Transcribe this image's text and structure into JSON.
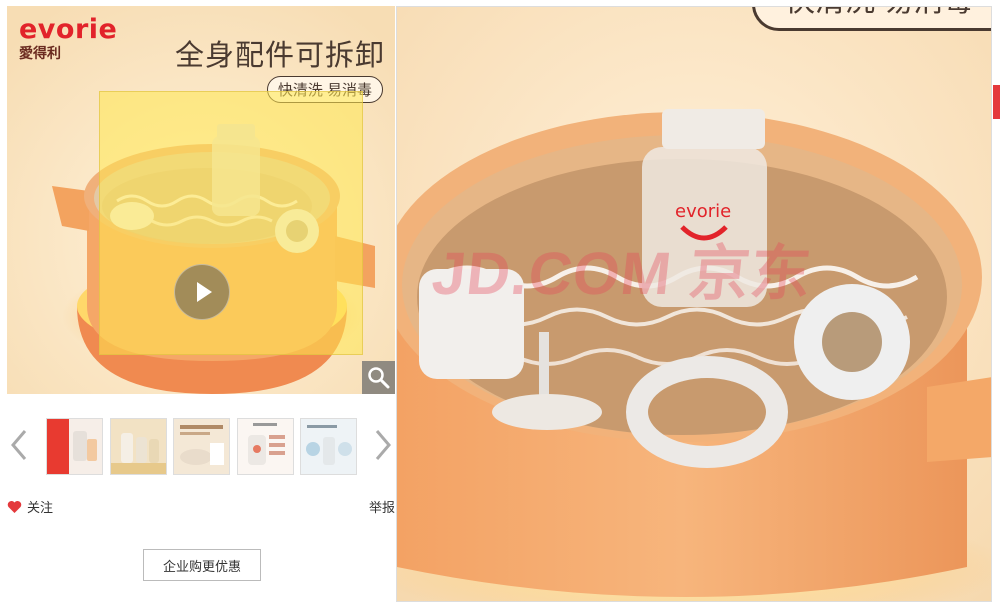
{
  "main_image": {
    "brand_en": "evorie",
    "brand_cn": "愛得利",
    "headline": "全身配件可拆卸",
    "subline": "快清洗 易消毒"
  },
  "zoom_preview": {
    "subline": "快清洗 易消毒",
    "watermark": "JD.COM 京东"
  },
  "thumbnails": [
    {
      "name": "thumb-1",
      "active": false
    },
    {
      "name": "thumb-2",
      "active": false
    },
    {
      "name": "thumb-3",
      "active": false
    },
    {
      "name": "thumb-4",
      "active": false
    },
    {
      "name": "thumb-5",
      "active": true
    }
  ],
  "actions": {
    "follow_label": "关注",
    "report_label": "举报",
    "enterprise_label": "企业购更优惠"
  },
  "colors": {
    "brand_red": "#e2232a",
    "jd_red": "#e4393c",
    "pot_orange": "#f3a35f",
    "background_cream": "#fbe9c9"
  },
  "icons": [
    "play-icon",
    "magnifier-icon",
    "chevron-left-icon",
    "chevron-right-icon",
    "heart-icon"
  ]
}
